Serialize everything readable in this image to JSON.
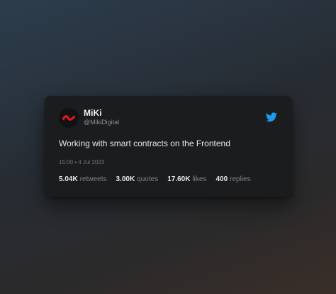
{
  "tweet": {
    "author_name": "MiKi",
    "author_handle": "@MikiDigital",
    "text": "Working with smart contracts on the Frontend",
    "timestamp": "15:00 • 4 Jul 2023",
    "icons": {
      "avatar": "miki-logo-icon",
      "platform": "twitter-bird-icon"
    },
    "colors": {
      "card_background": "#1b1c1e",
      "twitter_blue": "#1d9bf0",
      "logo_red": "#e0161f"
    },
    "stats": [
      {
        "value": "5.04K",
        "label": "retweets"
      },
      {
        "value": "3.00K",
        "label": "quotes"
      },
      {
        "value": "17.60K",
        "label": "likes"
      },
      {
        "value": "400",
        "label": "replies"
      }
    ]
  }
}
